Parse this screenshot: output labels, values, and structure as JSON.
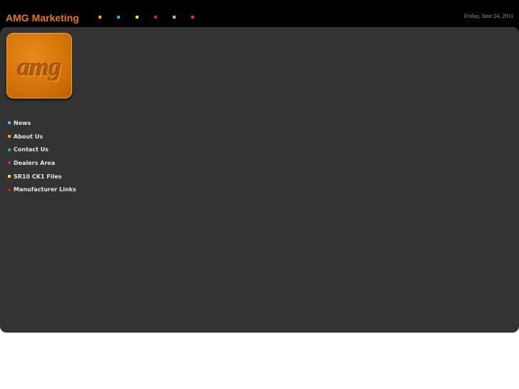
{
  "header": {
    "title": "AMG Marketing",
    "date": "Friday, June 24, 2011",
    "dots": [
      {
        "icon": "square-dot-icon",
        "color": "#f5a623"
      },
      {
        "icon": "square-dot-icon",
        "color": "#2bb0e0"
      },
      {
        "icon": "square-dot-icon",
        "color": "#f0e020"
      },
      {
        "icon": "square-dot-icon",
        "color": "#e02020"
      },
      {
        "icon": "square-dot-icon",
        "color": "#6cc8f0"
      },
      {
        "icon": "square-dot-icon",
        "color": "#e0208a"
      }
    ]
  },
  "logo": {
    "text": "amg",
    "color": "#d4720a"
  },
  "nav": {
    "items": [
      {
        "label": "News",
        "bullet_color": "#5ab4f0"
      },
      {
        "label": "About Us",
        "bullet_color": "#f0a020"
      },
      {
        "label": "Contact Us",
        "bullet_color": "#20b0a0"
      },
      {
        "label": "Dealers Area",
        "bullet_color": "#c0208a"
      },
      {
        "label": "SR10  CK1 Files",
        "bullet_color": "#f0e020"
      },
      {
        "label": "Manufacturer Links",
        "bullet_color": "#c01a1a"
      }
    ]
  },
  "colors": {
    "topbar": "#000000",
    "panel": "#333333",
    "accent": "#e07b10"
  }
}
